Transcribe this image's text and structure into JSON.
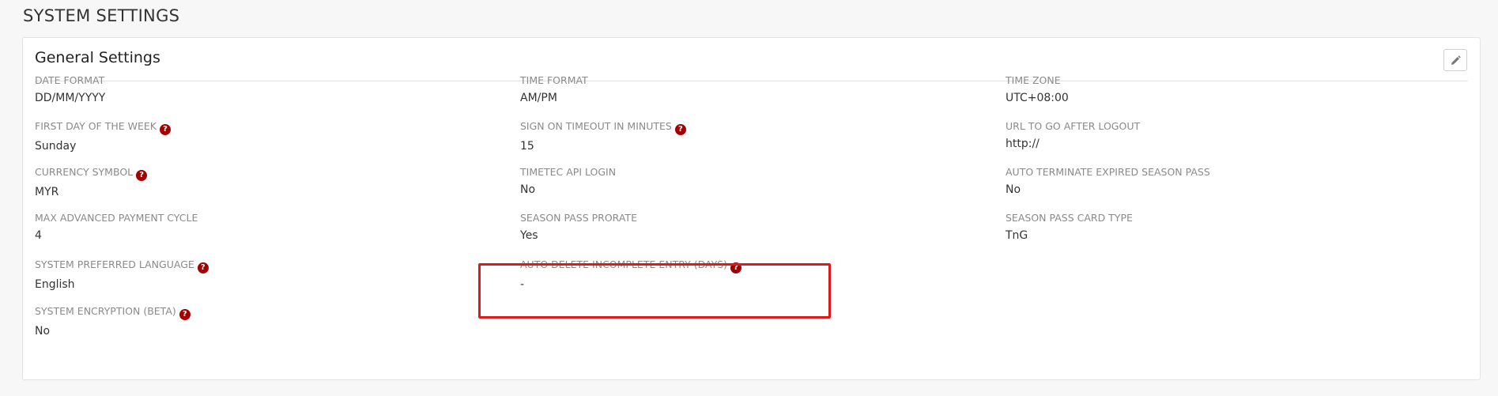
{
  "page": {
    "title": "SYSTEM SETTINGS"
  },
  "panel": {
    "title": "General Settings",
    "edit_icon": "pencil-icon",
    "help_icon_glyph": "?"
  },
  "fields": {
    "date_format": {
      "label": "DATE FORMAT",
      "value": "DD/MM/YYYY"
    },
    "time_format": {
      "label": "TIME FORMAT",
      "value": "AM/PM"
    },
    "time_zone": {
      "label": "TIME ZONE",
      "value": "UTC+08:00"
    },
    "first_day_of_week": {
      "label": "FIRST DAY OF THE WEEK",
      "value": "Sunday"
    },
    "sign_on_timeout": {
      "label": "SIGN ON TIMEOUT IN MINUTES",
      "value": "15"
    },
    "url_after_logout": {
      "label": "URL TO GO AFTER LOGOUT",
      "value": "http://"
    },
    "currency_symbol": {
      "label": "CURRENCY SYMBOL",
      "value": "MYR"
    },
    "timetec_api_login": {
      "label": "TIMETEC API LOGIN",
      "value": "No"
    },
    "auto_terminate_season_pass": {
      "label": "AUTO TERMINATE EXPIRED SEASON PASS",
      "value": "No"
    },
    "max_advanced_payment_cycle": {
      "label": "MAX ADVANCED PAYMENT CYCLE",
      "value": "4"
    },
    "season_pass_prorate": {
      "label": "SEASON PASS PRORATE",
      "value": "Yes"
    },
    "season_pass_card_type": {
      "label": "SEASON PASS CARD TYPE",
      "value": "TnG"
    },
    "system_preferred_language": {
      "label": "SYSTEM PREFERRED LANGUAGE",
      "value": "English"
    },
    "auto_delete_incomplete_entry": {
      "label": "AUTO DELETE INCOMPLETE ENTRY (DAYS)",
      "value": "-"
    },
    "system_encryption": {
      "label": "SYSTEM ENCRYPTION (BETA)",
      "value": "No"
    }
  },
  "colors": {
    "help_icon": "#a30000",
    "highlight_border": "#e01a1a"
  }
}
